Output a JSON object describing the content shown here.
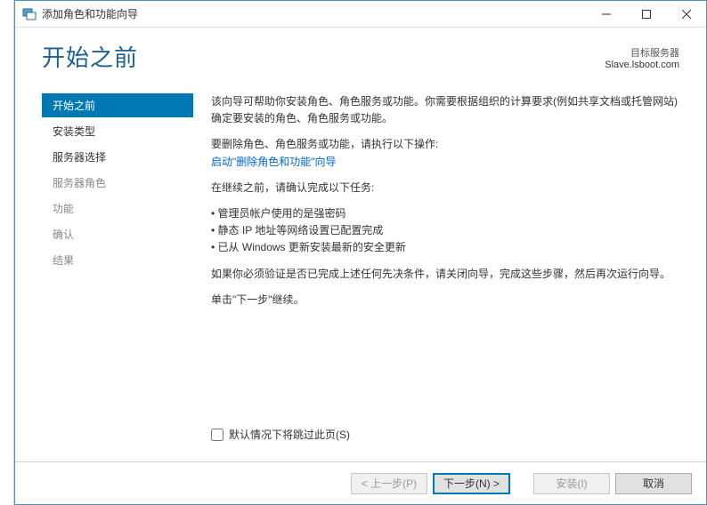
{
  "window": {
    "title": "添加角色和功能向导"
  },
  "header": {
    "heading": "开始之前",
    "target_label": "目标服务器",
    "target_value": "Slave.lsboot.com"
  },
  "sidebar": {
    "steps": [
      {
        "label": "开始之前",
        "active": true,
        "enabled": true
      },
      {
        "label": "安装类型",
        "active": false,
        "enabled": true
      },
      {
        "label": "服务器选择",
        "active": false,
        "enabled": true
      },
      {
        "label": "服务器角色",
        "active": false,
        "enabled": false
      },
      {
        "label": "功能",
        "active": false,
        "enabled": false
      },
      {
        "label": "确认",
        "active": false,
        "enabled": false
      },
      {
        "label": "结果",
        "active": false,
        "enabled": false
      }
    ]
  },
  "content": {
    "intro": "该向导可帮助你安装角色、角色服务或功能。你需要根据组织的计算要求(例如共享文档或托管网站)确定要安装的角色、角色服务或功能。",
    "remove_lead": "要删除角色、角色服务或功能，请执行以下操作:",
    "remove_link": "启动\"删除角色和功能\"向导",
    "before_continue": "在继续之前，请确认完成以下任务:",
    "bullets": [
      "管理员帐户使用的是强密码",
      "静态 IP 地址等网络设置已配置完成",
      "已从 Windows 更新安装最新的安全更新"
    ],
    "verify": "如果你必须验证是否已完成上述任何先决条件，请关闭向导，完成这些步骤，然后再次运行向导。",
    "continue_hint": "单击\"下一步\"继续。",
    "skip_checkbox": "默认情况下将跳过此页(S)"
  },
  "footer": {
    "prev": "< 上一步(P)",
    "next": "下一步(N) >",
    "install": "安装(I)",
    "cancel": "取消"
  }
}
